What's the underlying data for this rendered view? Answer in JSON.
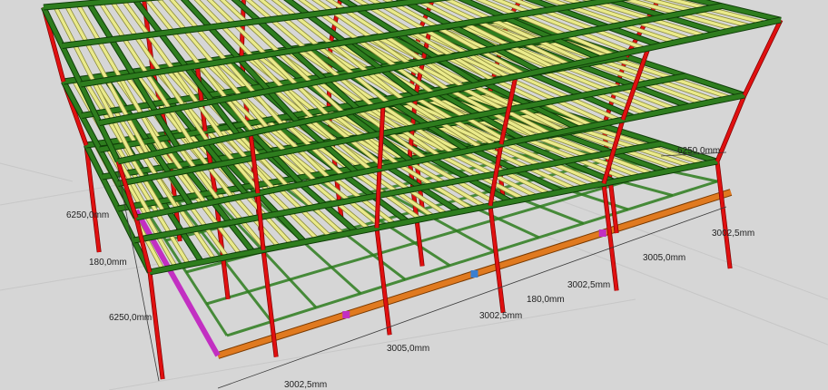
{
  "dimensions": {
    "left_story_height_upper": "6250,0mm",
    "left_slab_thickness": "180,0mm",
    "left_story_height_lower": "6250,0mm",
    "right_story_height": "6250,0mm",
    "bay_a1": "3002,5mm",
    "bay_b1": "3005,0mm",
    "bay_a2": "3002,5mm",
    "bay_a3": "3002,5mm",
    "slab_mid": "180,0mm",
    "bay_b2": "3005,0mm",
    "bay_a4": "3002,5mm"
  },
  "colors": {
    "background": "#d6d6d6",
    "beam_green": "#2e7d1e",
    "beam_green_edge": "#0f3d08",
    "joist_yellow": "#eaea8a",
    "joist_yellow_edge": "#8a8a3a",
    "column_red": "#e01010",
    "ground_beam_orange": "#e07a20",
    "ground_beam_magenta": "#c22fc2",
    "ground_beam_blue": "#3a7fd0"
  }
}
